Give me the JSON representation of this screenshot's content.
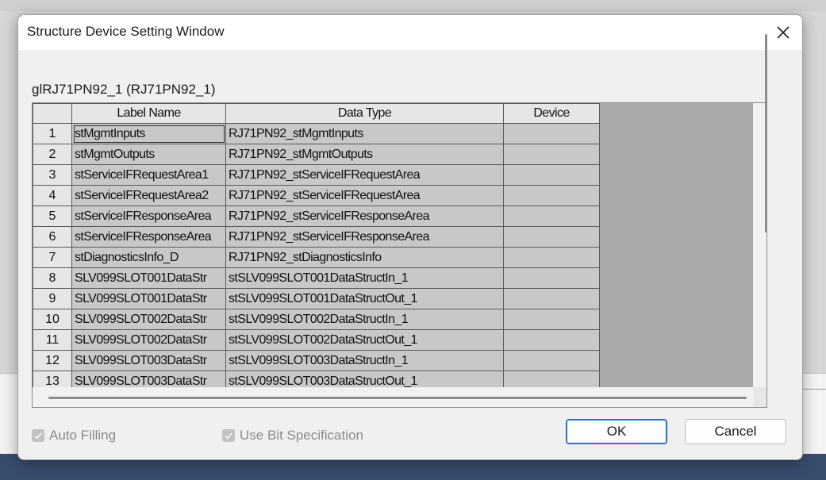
{
  "window": {
    "title": "Structure Device Setting Window"
  },
  "structure": {
    "label": "glRJ71PN92_1 (RJ71PN92_1)"
  },
  "table": {
    "columns": [
      "Label Name",
      "Data Type",
      "Device"
    ],
    "rows": [
      {
        "num": "1",
        "label": "stMgmtInputs",
        "type": "RJ71PN92_stMgmtInputs",
        "device": ""
      },
      {
        "num": "2",
        "label": "stMgmtOutputs",
        "type": "RJ71PN92_stMgmtOutputs",
        "device": ""
      },
      {
        "num": "3",
        "label": "stServiceIFRequestArea1",
        "type": "RJ71PN92_stServiceIFRequestArea",
        "device": ""
      },
      {
        "num": "4",
        "label": "stServiceIFRequestArea2",
        "type": "RJ71PN92_stServiceIFRequestArea",
        "device": ""
      },
      {
        "num": "5",
        "label": "stServiceIFResponseArea",
        "type": "RJ71PN92_stServiceIFResponseArea",
        "device": ""
      },
      {
        "num": "6",
        "label": "stServiceIFResponseArea",
        "type": "RJ71PN92_stServiceIFResponseArea",
        "device": ""
      },
      {
        "num": "7",
        "label": "stDiagnosticsInfo_D",
        "type": "RJ71PN92_stDiagnosticsInfo",
        "device": ""
      },
      {
        "num": "8",
        "label": "SLV099SLOT001DataStr",
        "type": "stSLV099SLOT001DataStructIn_1",
        "device": ""
      },
      {
        "num": "9",
        "label": "SLV099SLOT001DataStr",
        "type": "stSLV099SLOT001DataStructOut_1",
        "device": ""
      },
      {
        "num": "10",
        "label": "SLV099SLOT002DataStr",
        "type": "stSLV099SLOT002DataStructIn_1",
        "device": ""
      },
      {
        "num": "11",
        "label": "SLV099SLOT002DataStr",
        "type": "stSLV099SLOT002DataStructOut_1",
        "device": ""
      },
      {
        "num": "12",
        "label": "SLV099SLOT003DataStr",
        "type": "stSLV099SLOT003DataStructIn_1",
        "device": ""
      },
      {
        "num": "13",
        "label": "SLV099SLOT003DataStr",
        "type": "stSLV099SLOT003DataStructOut_1",
        "device": ""
      }
    ]
  },
  "options": {
    "auto_filling": "Auto Filling",
    "use_bit_specification": "Use Bit Specification"
  },
  "buttons": {
    "ok": "OK",
    "cancel": "Cancel"
  },
  "icons": {
    "close": "close-icon",
    "check": "checkmark-icon"
  }
}
